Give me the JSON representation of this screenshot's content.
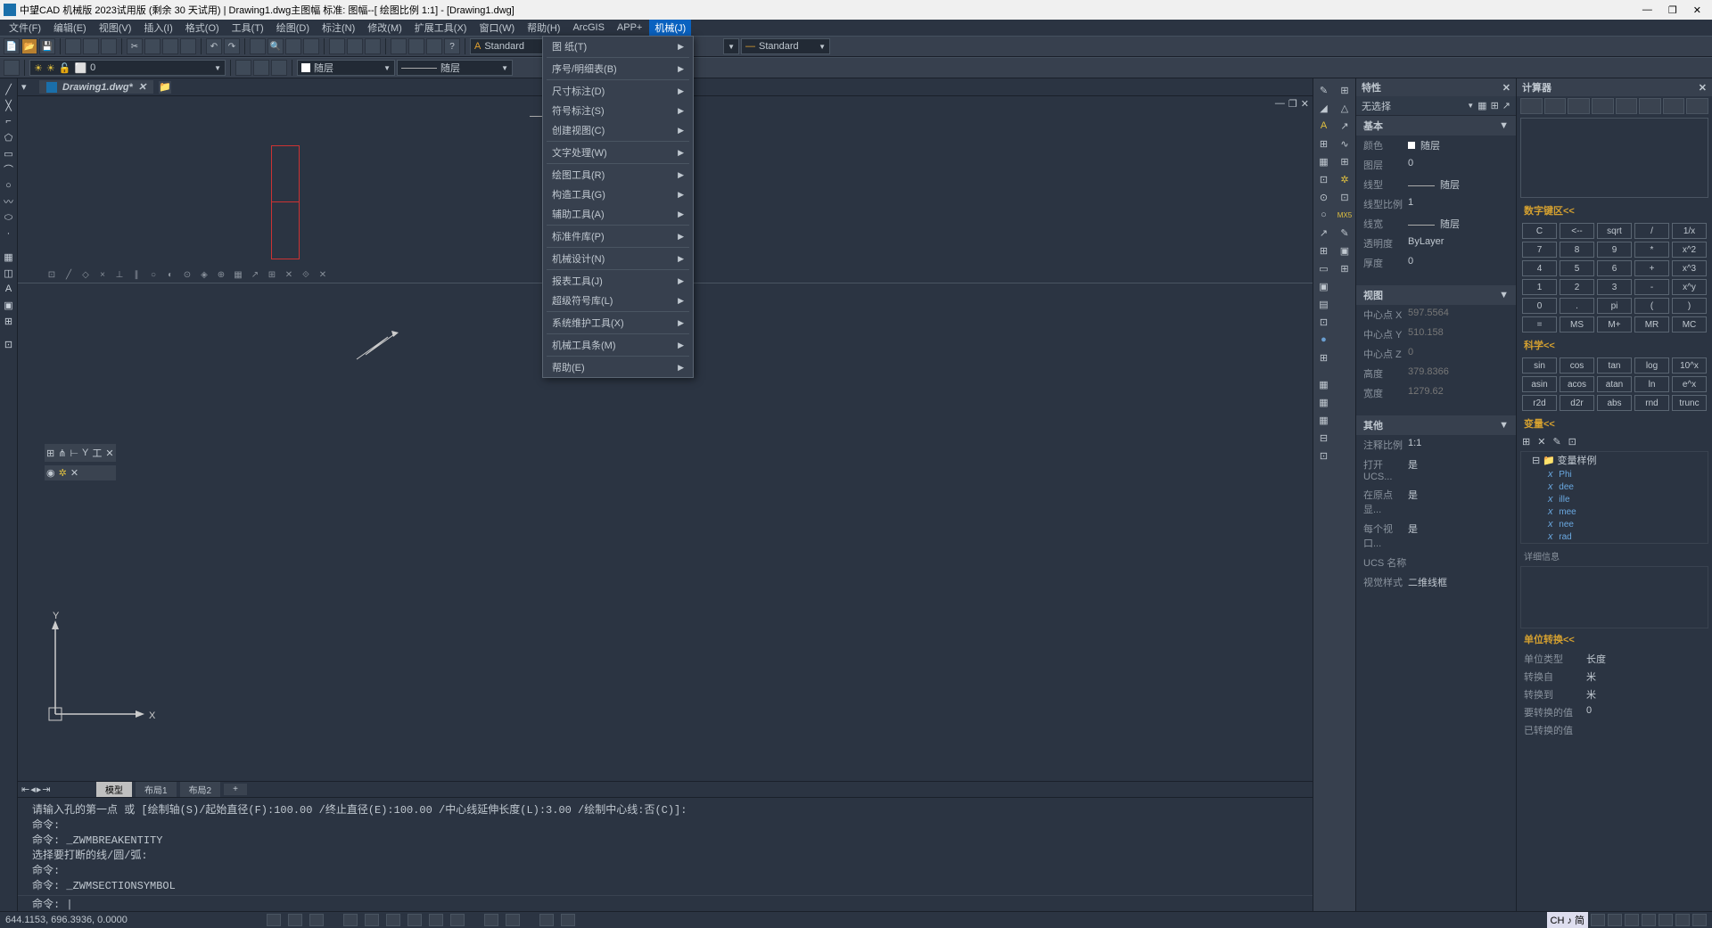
{
  "title": "中望CAD 机械版 2023试用版 (剩余 30 天试用) | Drawing1.dwg主图幅  标准: 图幅--[ 绘图比例 1:1] - [Drawing1.dwg]",
  "menubar": [
    "文件(F)",
    "编辑(E)",
    "视图(V)",
    "插入(I)",
    "格式(O)",
    "工具(T)",
    "绘图(D)",
    "标注(N)",
    "修改(M)",
    "扩展工具(X)",
    "窗口(W)",
    "帮助(H)",
    "ArcGIS",
    "APP+",
    "机械(J)"
  ],
  "filetab": "Drawing1.dwg*",
  "stdcombo1": "Standard",
  "stdcombo2": "Standard",
  "layercombo": "随层",
  "ltcombo": "随层",
  "dropdown": [
    {
      "t": "图  纸(T)",
      "a": true
    },
    {
      "sep": true
    },
    {
      "t": "序号/明细表(B)",
      "a": true
    },
    {
      "sep": true
    },
    {
      "t": "尺寸标注(D)",
      "a": true
    },
    {
      "t": "符号标注(S)",
      "a": true
    },
    {
      "t": "创建视图(C)",
      "a": true
    },
    {
      "sep": true
    },
    {
      "t": "文字处理(W)",
      "a": true
    },
    {
      "sep": true
    },
    {
      "t": "绘图工具(R)",
      "a": true
    },
    {
      "t": "构造工具(G)",
      "a": true
    },
    {
      "t": "辅助工具(A)",
      "a": true
    },
    {
      "sep": true
    },
    {
      "t": "标准件库(P)",
      "a": true
    },
    {
      "sep": true
    },
    {
      "t": "机械设计(N)",
      "a": true
    },
    {
      "sep": true
    },
    {
      "t": "报表工具(J)",
      "a": true
    },
    {
      "t": "超级符号库(L)",
      "a": true
    },
    {
      "sep": true
    },
    {
      "t": "系统维护工具(X)",
      "a": true
    },
    {
      "sep": true
    },
    {
      "t": "机械工具条(M)",
      "a": true
    },
    {
      "sep": true
    },
    {
      "t": "帮助(E)",
      "a": true
    }
  ],
  "bottomtabs": [
    "模型",
    "布局1",
    "布局2",
    "+"
  ],
  "cmdlines": "请输入孔的第一点 或 [绘制轴(S)/起始直径(F):100.00 /终止直径(E):100.00 /中心线延伸长度(L):3.00 /绘制中心线:否(C)]:\n命令:\n命令: _ZWMBREAKENTITY\n选择要打断的线/圆/弧:\n命令:\n命令: _ZWMSECTIONSYMBOL",
  "cmdprompt": "命令: |",
  "coords": "644.1153, 696.3936, 0.0000",
  "props": {
    "title": "特性",
    "nosel": "无选择",
    "sect1": "基本",
    "color_k": "颜色",
    "color_v": "随层",
    "layer_k": "图层",
    "layer_v": "0",
    "ltype_k": "线型",
    "ltype_v": "随层",
    "ltscale_k": "线型比例",
    "ltscale_v": "1",
    "lw_k": "线宽",
    "lw_v": "随层",
    "trans_k": "透明度",
    "trans_v": "ByLayer",
    "thick_k": "厚度",
    "thick_v": "0",
    "sect2": "视图",
    "cx_k": "中心点 X",
    "cx_v": "597.5564",
    "cy_k": "中心点 Y",
    "cy_v": "510.158",
    "cz_k": "中心点 Z",
    "cz_v": "0",
    "h_k": "高度",
    "h_v": "379.8366",
    "w_k": "宽度",
    "w_v": "1279.62",
    "sect3": "其他",
    "anno_k": "注释比例",
    "anno_v": "1:1",
    "ucs_k": "打开 UCS...",
    "ucs_v": "是",
    "orig_k": "在原点显...",
    "orig_v": "是",
    "vp_k": "每个视口...",
    "vp_v": "是",
    "ucsn_k": "UCS 名称",
    "ucsn_v": "",
    "vs_k": "视觉样式",
    "vs_v": "二维线框"
  },
  "calc": {
    "title": "计算器",
    "numpad_t": "数字键区<<",
    "numpad": [
      "C",
      "<--",
      "sqrt",
      "/",
      "1/x",
      "7",
      "8",
      "9",
      "*",
      "x^2",
      "4",
      "5",
      "6",
      "+",
      "x^3",
      "1",
      "2",
      "3",
      "-",
      "x^y",
      "0",
      ".",
      "pi",
      "(",
      ")",
      "=",
      "MS",
      "M+",
      "MR",
      "MC"
    ],
    "sci_t": "科学<<",
    "sci": [
      "sin",
      "cos",
      "tan",
      "log",
      "10^x",
      "asin",
      "acos",
      "atan",
      "ln",
      "e^x",
      "r2d",
      "d2r",
      "abs",
      "rnd",
      "trunc"
    ],
    "var_t": "变量<<",
    "varroot": "变量样例",
    "vars": [
      "Phi",
      "dee",
      "ille",
      "mee",
      "nee",
      "rad"
    ],
    "detail_t": "详细信息",
    "unit_t": "单位转换<<",
    "utype_k": "单位类型",
    "utype_v": "长度",
    "from_k": "转换自",
    "from_v": "米",
    "to_k": "转换到",
    "to_v": "米",
    "val_k": "要转换的值",
    "val_v": "0",
    "res_k": "已转换的值"
  },
  "ime": "CH ♪ 简"
}
